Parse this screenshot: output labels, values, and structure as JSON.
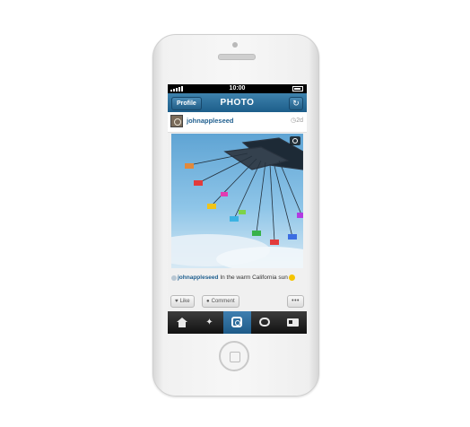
{
  "status_bar": {
    "time": "10:00"
  },
  "nav": {
    "profile_label": "Profile",
    "title": "PHOTO"
  },
  "post": {
    "username": "johnappleseed",
    "timestamp": "2d",
    "caption_user": "johnappleseed",
    "caption_text": " In the warm California sun"
  },
  "actions": {
    "like_label": "Like",
    "comment_label": "Comment",
    "more_label": "•••"
  },
  "tabs": [
    {
      "name": "home-icon",
      "active": false
    },
    {
      "name": "explore-icon",
      "active": false
    },
    {
      "name": "camera-icon",
      "active": true
    },
    {
      "name": "activity-icon",
      "active": false
    },
    {
      "name": "profile-card-icon",
      "active": false
    }
  ],
  "colors": {
    "nav_blue": "#1d5e8a",
    "link_blue": "#1f5f8f",
    "tab_active": "#3f7fb0"
  }
}
